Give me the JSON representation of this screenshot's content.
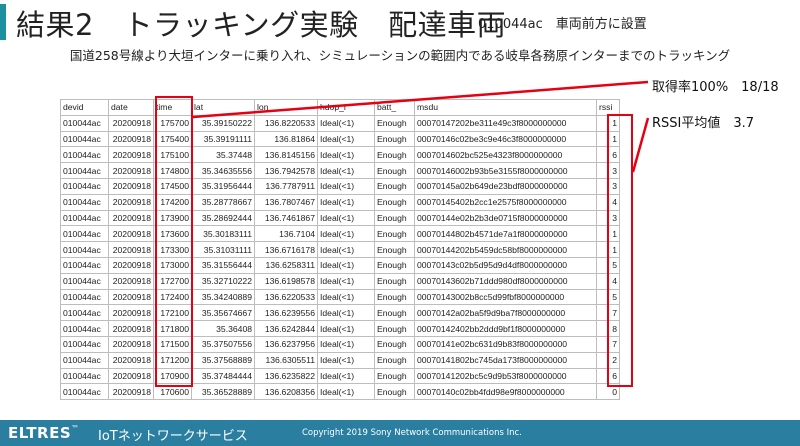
{
  "header": {
    "title": "結果2　トラッキング実験　配達車両",
    "subtitle_right": "010044ac　車両前方に設置",
    "description": "国道258号線より大垣インターに乗り入れ、シミュレーションの範囲内である岐阜各務原インターまでのトラッキング"
  },
  "annotations": {
    "acquisition_rate": "取得率100%　18/18",
    "rssi_avg": "RSSI平均値　3.7"
  },
  "colors": {
    "highlight": "#e60012",
    "footer": "#2a7ea0",
    "title_accent": "#1c8fa0"
  },
  "table": {
    "columns": [
      "devid",
      "date",
      "time",
      "lat",
      "lon",
      "hdop_r",
      "batt_",
      "msdu",
      "rssi"
    ],
    "rows": [
      [
        "010044ac",
        "20200918",
        "175700",
        "35.39150222",
        "136.8220533",
        "Ideal(<1)",
        "Enough",
        "00070147202be311e49c3f8000000000",
        "1"
      ],
      [
        "010044ac",
        "20200918",
        "175400",
        "35.39191111",
        "136.81864",
        "Ideal(<1)",
        "Enough",
        "00070146c02be3c9e46c3f8000000000",
        "1"
      ],
      [
        "010044ac",
        "20200918",
        "175100",
        "35.37448",
        "136.8145156",
        "Ideal(<1)",
        "Enough",
        "0007014602bc525e4323f8000000000",
        "6"
      ],
      [
        "010044ac",
        "20200918",
        "174800",
        "35.34635556",
        "136.7942578",
        "Ideal(<1)",
        "Enough",
        "00070146002b93b5e3155f8000000000",
        "3"
      ],
      [
        "010044ac",
        "20200918",
        "174500",
        "35.31956444",
        "136.7787911",
        "Ideal(<1)",
        "Enough",
        "00070145a02b649de23bdf8000000000",
        "3"
      ],
      [
        "010044ac",
        "20200918",
        "174200",
        "35.28778667",
        "136.7807467",
        "Ideal(<1)",
        "Enough",
        "00070145402b2cc1e2575f8000000000",
        "4"
      ],
      [
        "010044ac",
        "20200918",
        "173900",
        "35.28692444",
        "136.7461867",
        "Ideal(<1)",
        "Enough",
        "00070144e02b2b3de0715f8000000000",
        "3"
      ],
      [
        "010044ac",
        "20200918",
        "173600",
        "35.30183111",
        "136.7104",
        "Ideal(<1)",
        "Enough",
        "00070144802b4571de7a1f8000000000",
        "1"
      ],
      [
        "010044ac",
        "20200918",
        "173300",
        "35.31031111",
        "136.6716178",
        "Ideal(<1)",
        "Enough",
        "00070144202b5459dc58bf8000000000",
        "1"
      ],
      [
        "010044ac",
        "20200918",
        "173000",
        "35.31556444",
        "136.6258311",
        "Ideal(<1)",
        "Enough",
        "00070143c02b5d95d9d4df8000000000",
        "5"
      ],
      [
        "010044ac",
        "20200918",
        "172700",
        "35.32710222",
        "136.6198578",
        "Ideal(<1)",
        "Enough",
        "00070143602b71ddd980df8000000000",
        "4"
      ],
      [
        "010044ac",
        "20200918",
        "172400",
        "35.34240889",
        "136.6220533",
        "Ideal(<1)",
        "Enough",
        "00070143002b8cc5d99fbf8000000000",
        "5"
      ],
      [
        "010044ac",
        "20200918",
        "172100",
        "35.35674667",
        "136.6239556",
        "Ideal(<1)",
        "Enough",
        "00070142a02ba5f9d9ba7f8000000000",
        "7"
      ],
      [
        "010044ac",
        "20200918",
        "171800",
        "35.36408",
        "136.6242844",
        "Ideal(<1)",
        "Enough",
        "00070142402bb2ddd9bf1f8000000000",
        "8"
      ],
      [
        "010044ac",
        "20200918",
        "171500",
        "35.37507556",
        "136.6237956",
        "Ideal(<1)",
        "Enough",
        "00070141e02bc631d9b83f8000000000",
        "7"
      ],
      [
        "010044ac",
        "20200918",
        "171200",
        "35.37568889",
        "136.6305511",
        "Ideal(<1)",
        "Enough",
        "00070141802bc745da173f8000000000",
        "2"
      ],
      [
        "010044ac",
        "20200918",
        "170900",
        "35.37484444",
        "136.6235822",
        "Ideal(<1)",
        "Enough",
        "00070141202bc5c9d9b53f8000000000",
        "6"
      ],
      [
        "010044ac",
        "20200918",
        "170600",
        "35.36528889",
        "136.6208356",
        "Ideal(<1)",
        "Enough",
        "00070140c02bb4fdd98e9f8000000000",
        "0"
      ]
    ]
  },
  "footer": {
    "brand": "ELTRES",
    "brand_tm": "™",
    "service": "IoTネットワークサービス",
    "copyright": "Copyright 2019 Sony Network Communications Inc."
  }
}
